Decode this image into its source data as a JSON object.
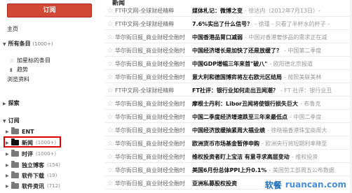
{
  "sidebar": {
    "subscribe_label": "订阅",
    "home": "主页",
    "all_items": {
      "label": "所有条目",
      "count": "(1000+)"
    },
    "starred": "加星标的条目",
    "trends": "趋势",
    "browse": "浏览资料",
    "explore": "探索",
    "subscriptions": "订阅",
    "folders": [
      {
        "name": "ENT",
        "count": ""
      },
      {
        "name": "新闻",
        "count": "(1000+)"
      },
      {
        "name": "时评",
        "count": "(1000+)"
      },
      {
        "name": "独立博客",
        "count": "(154)"
      },
      {
        "name": "软件下载",
        "count": "(19)"
      },
      {
        "name": "软件资讯",
        "count": "(712)"
      }
    ]
  },
  "main": {
    "header": "新闻",
    "rows": [
      {
        "source": "FT中文网-全球财经精粹",
        "title": "媒体札记：微博之变",
        "snippet": "- 徐达内（2012年7月13日）-"
      },
      {
        "source": "FT中文网-全球财经精粹",
        "title": "7.6%实出了什么信号？",
        "snippet": "- 徐瑾 - 只看了半杯水的杯子 -"
      },
      {
        "source": "华尔街日报_商业财经全融时",
        "title": "中国香港品胃口减弱",
        "snippet": "- 中国对香港奢侈品的需求正在减"
      },
      {
        "source": "华尔街日报_商业财经全融时",
        "title": "中国经济增长是加快了还是放缓了？",
        "snippet": "- 中国第二季度"
      },
      {
        "source": "华尔街日报_商业财经全融时",
        "title": "中国GDP增幅三年来首\"破八\"",
        "snippet": "- 欧阳德北京报道"
      },
      {
        "source": "华尔街日报_商业财经全融时",
        "title": "意大利和德国博弈将左右欧元区结局",
        "snippet": "- 按照美联美林"
      },
      {
        "source": "FT中文网-全球财经精粹",
        "title": "FT社评：银行业如何走出丑闻潮？",
        "snippet": "- FT 社评：银行业丑"
      },
      {
        "source": "华尔街日报_商业财经全融时",
        "title": "摩根士丹利：Libor丑闻将使银行损失巨大",
        "snippet": "- 布鲁克"
      },
      {
        "source": "华尔街日报_商业财经全融时",
        "title": "中国二季度经济增速跌至三年来最低点",
        "snippet": "- 中国二季度"
      },
      {
        "source": "华尔街日报_商业财经全融时",
        "title": "中国经济放缓抽紧周大福业绩",
        "snippet": "- 徐晓福香港珠宝商周大"
      },
      {
        "source": "华尔街日报_商业财经全融时",
        "title": "欧洲货币市场基金暂停申购",
        "snippet": "- 欧洲央行将短期利率降至"
      },
      {
        "source": "华尔街日报_商业财经全融时",
        "title": "维权投资者盯上宝洁 有意寻求高层变动",
        "snippet": "- 维权投资"
      },
      {
        "source": "华尔街日报_商业财经全融时",
        "title": "美国6月份总体PPI上升0.1%",
        "snippet": "- 美国劳工部周五公布数据"
      },
      {
        "source": "华尔街日报_商业财经全融时",
        "title": "亚洲私募股权投资",
        "snippet": ""
      }
    ]
  },
  "watermark": {
    "cn": "软餐",
    "en": "ruancan.com"
  }
}
